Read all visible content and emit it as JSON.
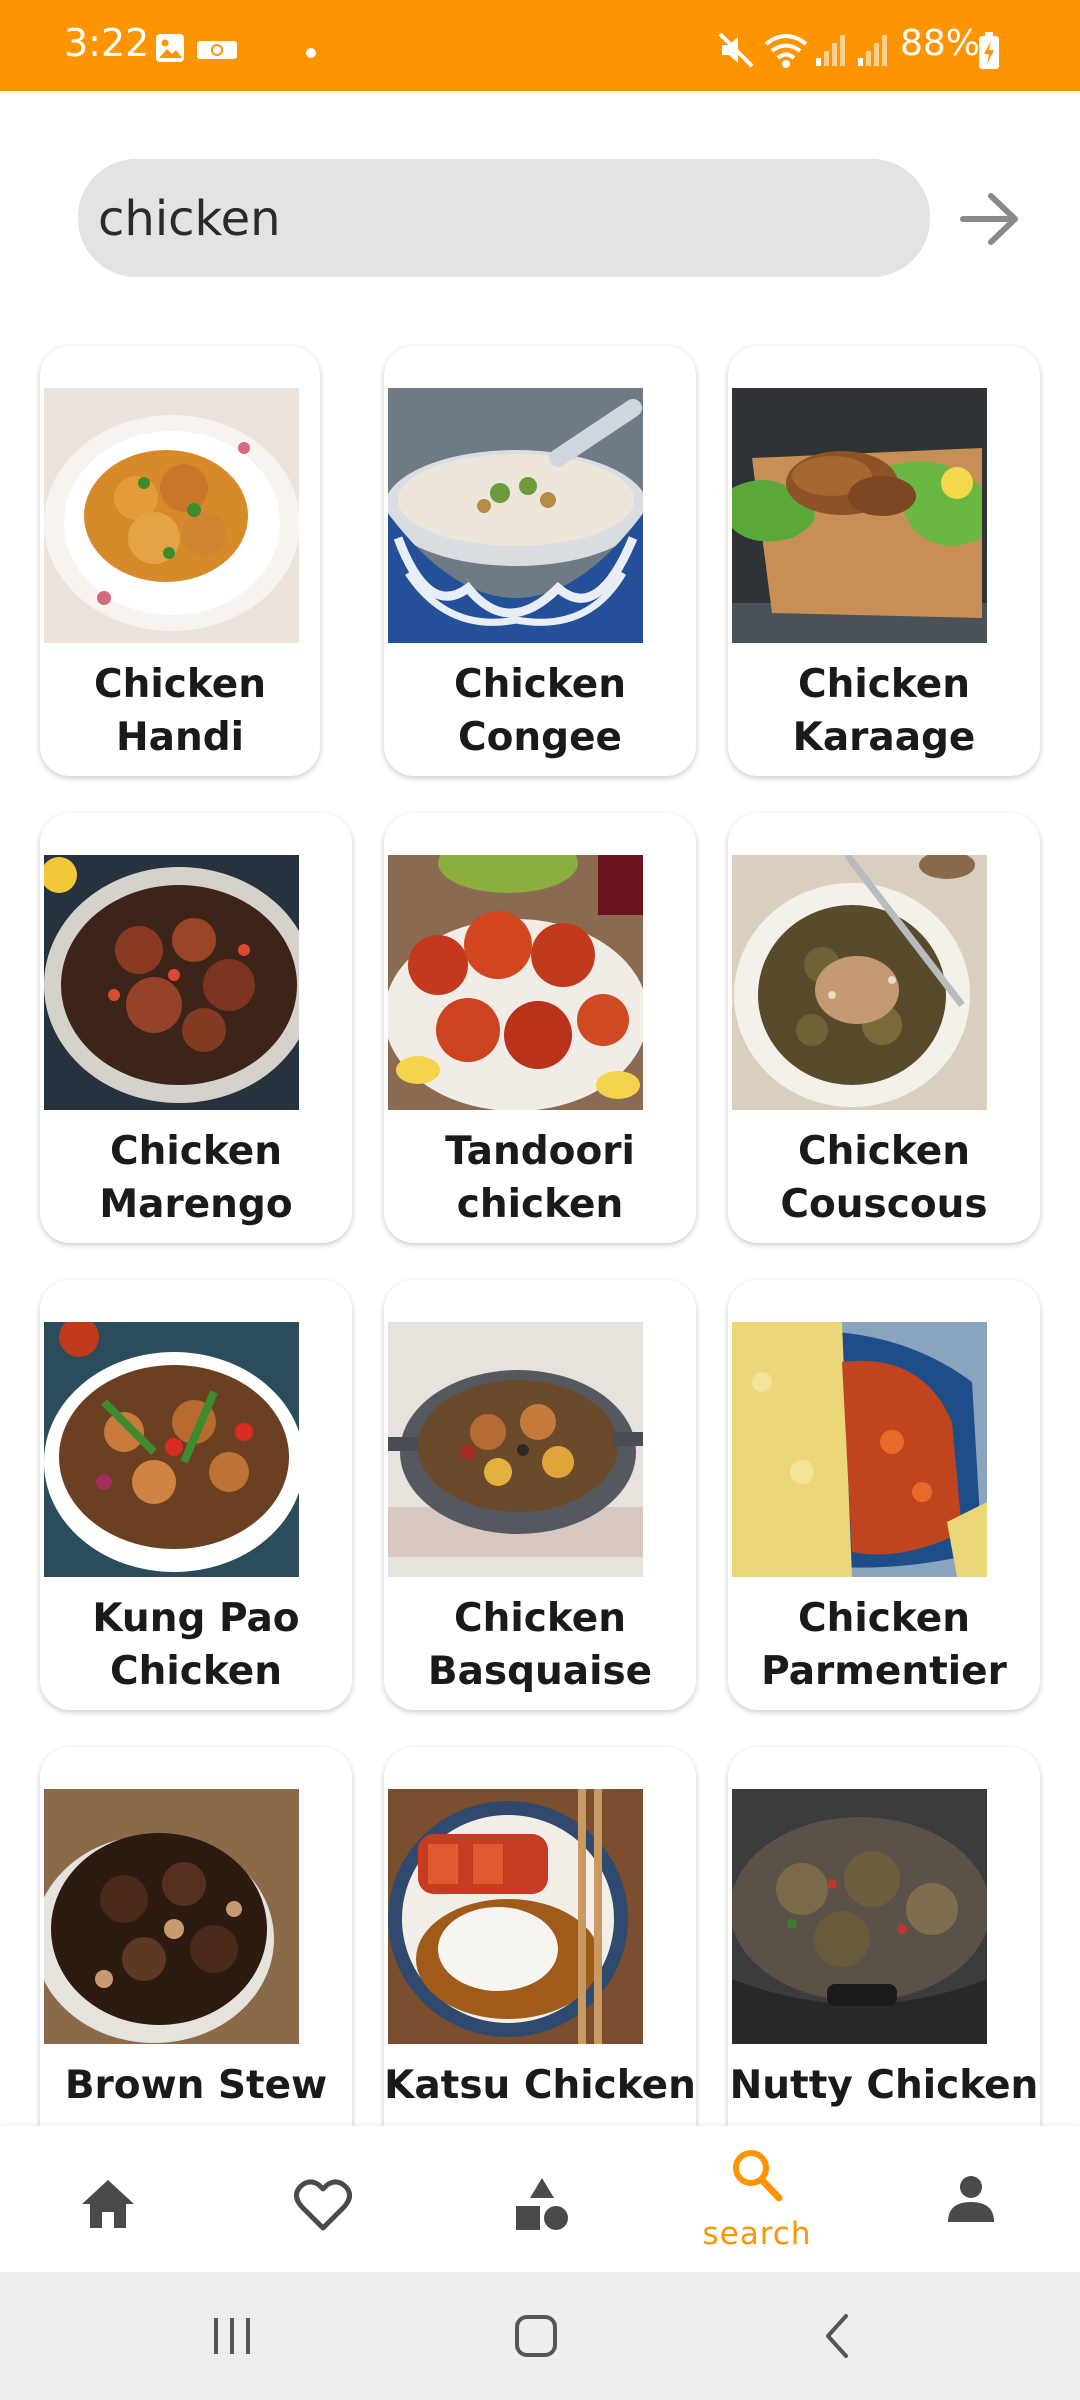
{
  "status_bar": {
    "time": "3:22",
    "battery": "88%",
    "icons": [
      "gallery-icon",
      "cast-icon",
      "dot-icon",
      "mute-icon",
      "wifi-icon",
      "signal-icon",
      "signal-icon",
      "battery-charging-icon"
    ]
  },
  "search": {
    "value": "chicken",
    "submit_icon": "arrow-right-icon"
  },
  "results": [
    {
      "title": "Chicken Handi"
    },
    {
      "title": "Chicken Congee"
    },
    {
      "title": "Chicken Karaage"
    },
    {
      "title": "Chicken Marengo"
    },
    {
      "title": "Tandoori chicken"
    },
    {
      "title": "Chicken Couscous"
    },
    {
      "title": "Kung Pao Chicken"
    },
    {
      "title": "Chicken Basquaise"
    },
    {
      "title": "Chicken Parmentier"
    },
    {
      "title": "Brown Stew"
    },
    {
      "title": "Katsu Chicken"
    },
    {
      "title": "Nutty Chicken"
    }
  ],
  "bottom_nav": {
    "items": [
      {
        "icon": "home-icon",
        "label": ""
      },
      {
        "icon": "heart-icon",
        "label": ""
      },
      {
        "icon": "categories-icon",
        "label": ""
      },
      {
        "icon": "search-icon",
        "label": "search"
      },
      {
        "icon": "person-icon",
        "label": ""
      }
    ],
    "active_color": "#fe9400",
    "inactive_color": "#4a4a4a"
  },
  "system_nav": {
    "icons": [
      "recents-icon",
      "home-button-icon",
      "back-icon"
    ]
  },
  "colors": {
    "accent": "#fe9400",
    "search_bg": "#e3e3e3"
  }
}
